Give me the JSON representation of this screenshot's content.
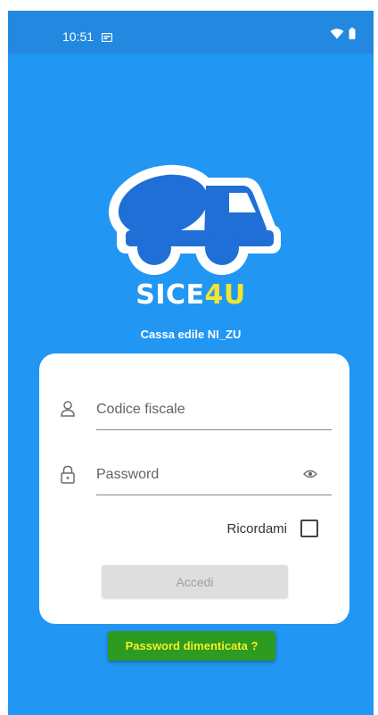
{
  "status_bar": {
    "time": "10:51",
    "icons": [
      "notification-icon",
      "wifi-icon",
      "battery-icon"
    ]
  },
  "logo": {
    "brand_main": "SICE",
    "brand_accent": "4U",
    "icon": "cement-mixer-truck-icon"
  },
  "subtitle": "Cassa edile NI_ZU",
  "login_form": {
    "fiscal_code_placeholder": "Codice fiscale",
    "fiscal_code_value": "",
    "password_placeholder": "Password",
    "password_value": "",
    "remember_label": "Ricordami",
    "remember_checked": false,
    "submit_label": "Accedi"
  },
  "forgot_password_label": "Password dimenticata ?",
  "colors": {
    "background": "#2196f3",
    "status_bar": "#2288e0",
    "brand_accent": "#f2e530",
    "forgot_button": "#2c9b1f",
    "forgot_text": "#f5ee28",
    "disabled_button": "#dedede"
  }
}
